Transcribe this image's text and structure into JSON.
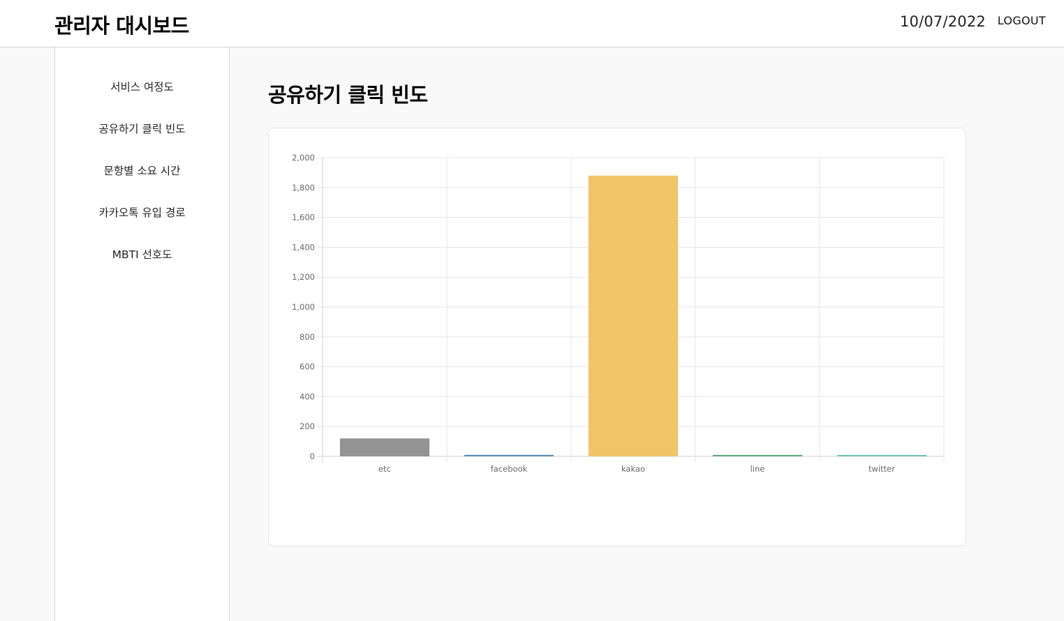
{
  "header": {
    "title": "관리자 대시보드",
    "date": "10/07/2022",
    "logout_label": "LOGOUT"
  },
  "sidebar": {
    "items": [
      {
        "label": "서비스 여정도"
      },
      {
        "label": "공유하기 클릭 빈도"
      },
      {
        "label": "문항별 소요 시간"
      },
      {
        "label": "카카오톡 유입 경로"
      },
      {
        "label": "MBTI 선호도"
      }
    ]
  },
  "main": {
    "title": "공유하기 클릭 빈도"
  },
  "chart_data": {
    "type": "bar",
    "categories": [
      "etc",
      "facebook",
      "kakao",
      "line",
      "twitter"
    ],
    "values": [
      120,
      10,
      1880,
      8,
      5
    ],
    "colors": [
      "#939393",
      "#5b8db8",
      "#f0c467",
      "#5fa97a",
      "#6fc4b0"
    ],
    "ylim": [
      0,
      2000
    ],
    "yticks": [
      "0",
      "200",
      "400",
      "600",
      "800",
      "1,000",
      "1,200",
      "1,400",
      "1,600",
      "1,800",
      "2,000"
    ],
    "grid": true
  }
}
